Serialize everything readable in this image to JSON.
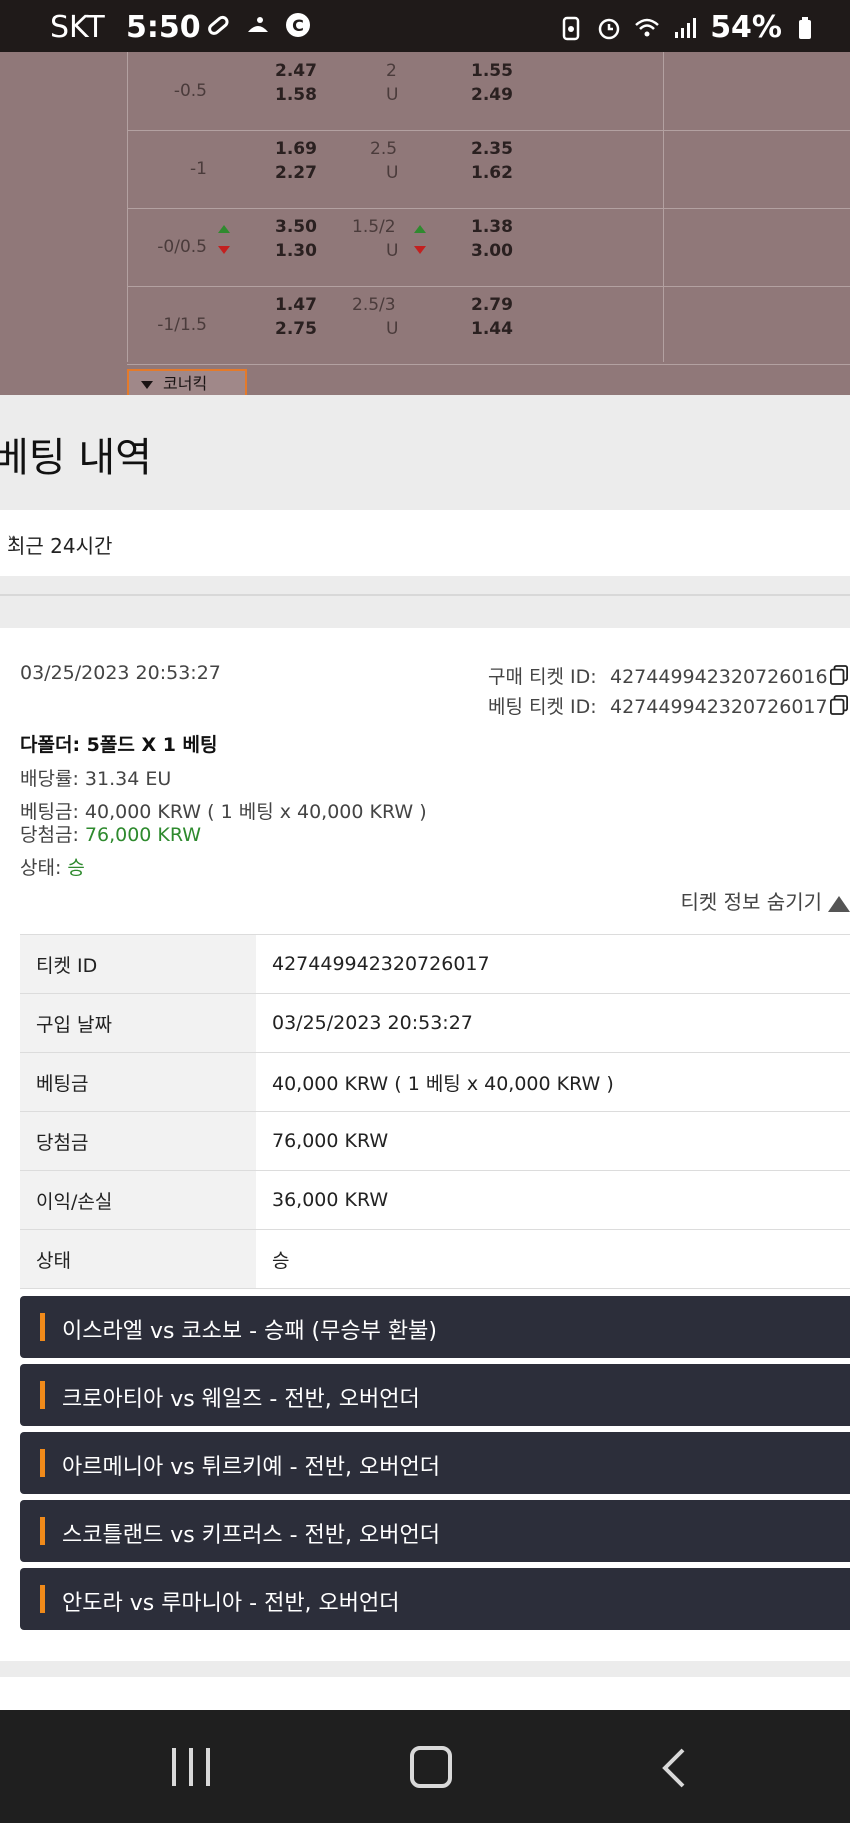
{
  "status_bar": {
    "carrier": "SKT",
    "time": "5:50",
    "battery": "54%"
  },
  "odds_rows": [
    {
      "handicap": "-0.5",
      "home": "2.47",
      "away": "1.58",
      "line": "2",
      "ou": "U",
      "over": "1.55",
      "under": "2.49"
    },
    {
      "handicap": "-1",
      "home": "1.69",
      "away": "2.27",
      "line": "2.5",
      "ou": "U",
      "over": "2.35",
      "under": "1.62"
    },
    {
      "handicap": "-0/0.5",
      "home": "3.50",
      "away": "1.30",
      "line": "1.5/2",
      "ou": "U",
      "over": "1.38",
      "under": "3.00"
    },
    {
      "handicap": "-1/1.5",
      "home": "1.47",
      "away": "2.75",
      "line": "2.5/3",
      "ou": "U",
      "over": "2.79",
      "under": "1.44"
    }
  ],
  "corner_kick_label": "코너킥",
  "section_title": "베팅 내역",
  "period_filter": "최근 24시간",
  "ticket": {
    "date": "03/25/2023 20:53:27",
    "purchase_id_label": "구매 티켓 ID:",
    "purchase_id": "427449942320726016",
    "bet_id_label": "베팅 티켓 ID:",
    "bet_id": "427449942320726017",
    "bet_type": "다폴더: 5폴드 X 1 베팅",
    "odds_label": "배당률:",
    "odds_value": "31.34 EU",
    "stake_label": "베팅금:",
    "stake_value": "40,000 KRW ( 1 베팅 x 40,000 KRW )",
    "win_label": "당첨금:",
    "win_value": "76,000 KRW",
    "status_label": "상태:",
    "status_value": "승",
    "toggle_label": "티켓 정보 숨기기"
  },
  "detail_table": [
    {
      "key": "티켓 ID",
      "value": "427449942320726017",
      "highlight": false
    },
    {
      "key": "구입 날짜",
      "value": "03/25/2023 20:53:27",
      "highlight": false
    },
    {
      "key": "베팅금",
      "value": "40,000 KRW ( 1 베팅 x 40,000 KRW )",
      "highlight": false
    },
    {
      "key": "당첨금",
      "value": "76,000 KRW",
      "highlight": true
    },
    {
      "key": "이익/손실",
      "value": "36,000 KRW",
      "highlight": true
    },
    {
      "key": "상태",
      "value": "승",
      "highlight": true
    }
  ],
  "matches": [
    "이스라엘 vs 코소보 - 승패 (무승부 환불)",
    "크로아티아 vs 웨일즈 - 전반, 오버언더",
    "아르메니아 vs 튀르키예 - 전반, 오버언더",
    "스코틀랜드 vs 키프러스 - 전반, 오버언더",
    "안도라 vs 루마니아 - 전반, 오버언더"
  ],
  "colors": {
    "win_green": "#2e8a2e",
    "accent_orange": "#f08a1a",
    "match_bg": "#2c2e3a"
  }
}
